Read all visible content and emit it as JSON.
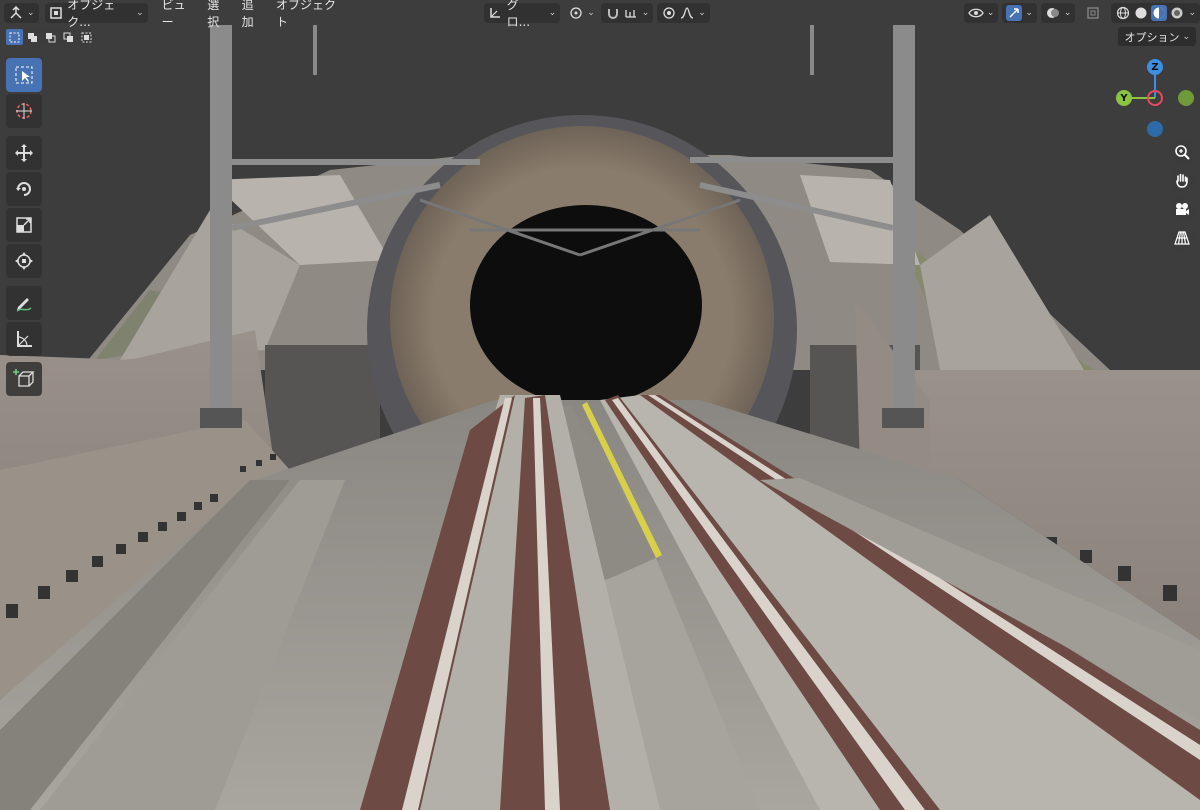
{
  "header": {
    "mode_label": "オブジェク...",
    "menus": [
      "ビュー",
      "選択",
      "追加",
      "オブジェクト"
    ],
    "transform_orientation": "グロ...",
    "options_label": "オプション"
  },
  "toolbar": {
    "tools": [
      "select-box",
      "cursor",
      "move",
      "rotate",
      "scale",
      "transform",
      "annotate",
      "measure",
      "add-cube"
    ],
    "active_tool": "select-box"
  },
  "gizmo": {
    "z_label": "Z",
    "y_label": "Y",
    "x_color": "#e84a5f",
    "y_color": "#8bc43f",
    "z_color": "#3d8fdf"
  },
  "colors": {
    "accent": "#4772b3",
    "viewport_bg": "#3d3d3d"
  }
}
